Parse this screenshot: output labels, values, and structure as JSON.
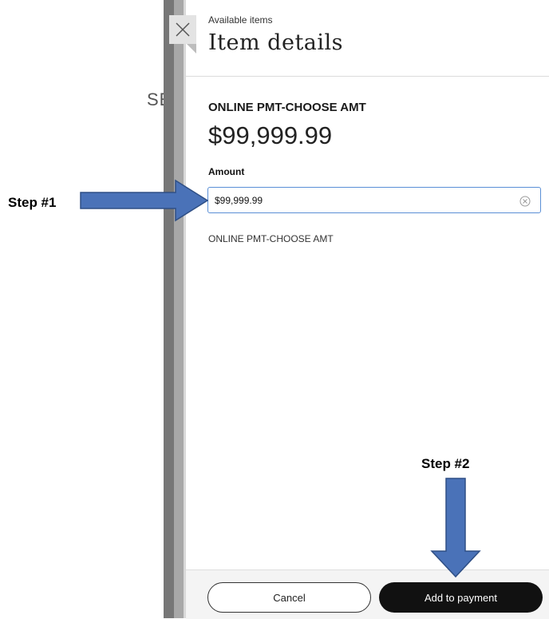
{
  "background": {
    "peek_text": "SE ."
  },
  "panel": {
    "breadcrumb": "Available items",
    "title": "Item details",
    "close_icon": "close-icon"
  },
  "item": {
    "name": "ONLINE PMT-CHOOSE AMT",
    "price": "$99,999.99",
    "amount_label": "Amount",
    "amount_value": "$99,999.99",
    "description": "ONLINE PMT-CHOOSE AMT"
  },
  "footer": {
    "cancel_label": "Cancel",
    "add_label": "Add to payment"
  },
  "annotations": {
    "step1": "Step #1",
    "step2": "Step #2",
    "arrow_color": "#4a72b8"
  },
  "colors": {
    "primary_button": "#111111",
    "input_border": "#5a8fd6"
  }
}
